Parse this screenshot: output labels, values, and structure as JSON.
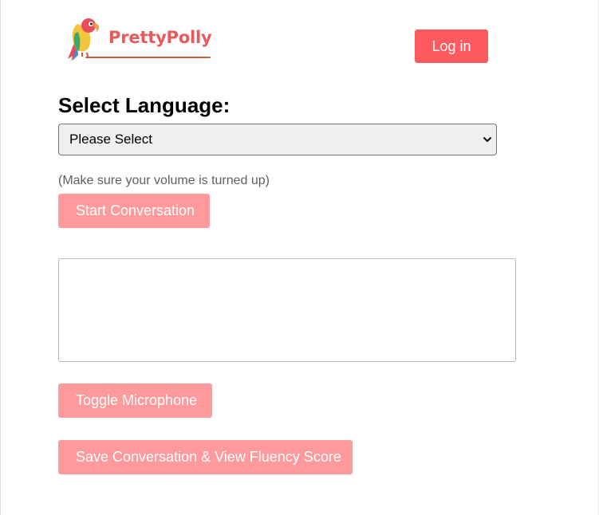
{
  "header": {
    "brand_name": "PrettyPolly",
    "logo_icon": "parrot-icon",
    "login_label": "Log in"
  },
  "language": {
    "title": "Select Language:",
    "selected_value": "Please Select"
  },
  "conversation": {
    "volume_hint": "(Make sure your volume is turned up)",
    "start_label": "Start Conversation",
    "transcript_text": "",
    "toggle_mic_label": "Toggle Microphone",
    "save_label": "Save Conversation & View Fluency Score"
  },
  "colors": {
    "brand": "#ff5a5f",
    "disabled_button": "#ff9a9c",
    "logo_text": "#e85a5a"
  }
}
